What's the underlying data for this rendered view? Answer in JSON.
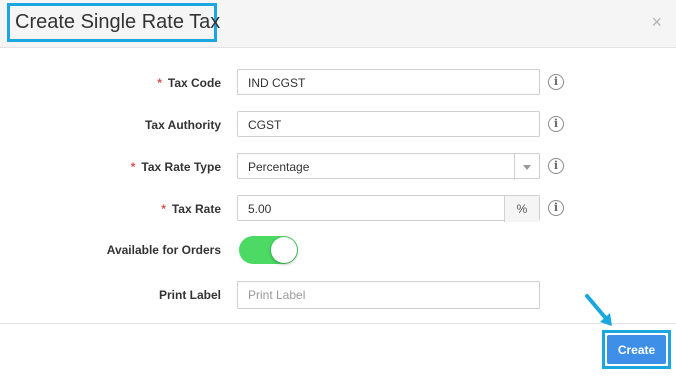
{
  "modal": {
    "title": "Create Single Rate Tax",
    "close_glyph": "×"
  },
  "form": {
    "tax_code": {
      "label": "Tax Code",
      "required": "*",
      "value": "IND CGST"
    },
    "tax_authority": {
      "label": "Tax Authority",
      "value": "CGST"
    },
    "tax_rate_type": {
      "label": "Tax Rate Type",
      "required": "*",
      "selected": "Percentage"
    },
    "tax_rate": {
      "label": "Tax Rate",
      "required": "*",
      "value": "5.00",
      "unit": "%"
    },
    "available_for_orders": {
      "label": "Available for Orders",
      "enabled": true
    },
    "print_label": {
      "label": "Print Label",
      "placeholder": "Print Label"
    },
    "info_glyph": "i"
  },
  "footer": {
    "create_label": "Create"
  },
  "colors": {
    "highlight": "#1aa7e0",
    "primary_button": "#3d8fe8",
    "toggle_on": "#4cd964",
    "required": "#d9534f"
  }
}
